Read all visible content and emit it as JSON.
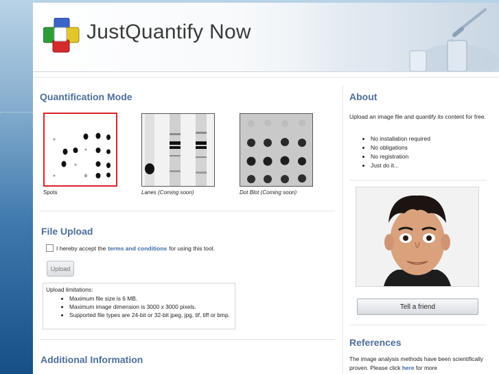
{
  "header": {
    "brand": "JustQuantify Now"
  },
  "mode": {
    "title": "Quantification Mode",
    "options": [
      {
        "label": "Spots",
        "selected": true
      },
      {
        "label": "Lanes (Coming soon)",
        "selected": false
      },
      {
        "label": "Dot Blot (Coming soon)",
        "selected": false
      }
    ]
  },
  "upload": {
    "title": "File Upload",
    "accept_prefix": "I hereby accept the",
    "terms_link": "terms and conditions",
    "accept_suffix": "for using this tool.",
    "button": "Upload",
    "limits_title": "Upload limitations:",
    "limits": [
      "Maximum file size is 6 MB.",
      "Maximum image dimension is 3000 x 3000 pixels.",
      "Supported file types are 24-bit or 32-bit jpeg, jpg, tif, tiff or bmp."
    ]
  },
  "additional": {
    "title": "Additional Information"
  },
  "about": {
    "title": "About",
    "text": "Upload an image file and quantify its content for free.",
    "bullets": [
      "No installation required",
      "No obligations",
      "No registration",
      "Just do it..."
    ],
    "tell_button": "Tell a friend"
  },
  "references": {
    "title": "References",
    "text_before": "The image analysis methods have been scientifically proven. Please click",
    "link": "here",
    "text_after": "for more"
  },
  "colors": {
    "heading": "#4a6e9a",
    "link": "#3c6ca8",
    "selected_border": "#d8232a"
  }
}
